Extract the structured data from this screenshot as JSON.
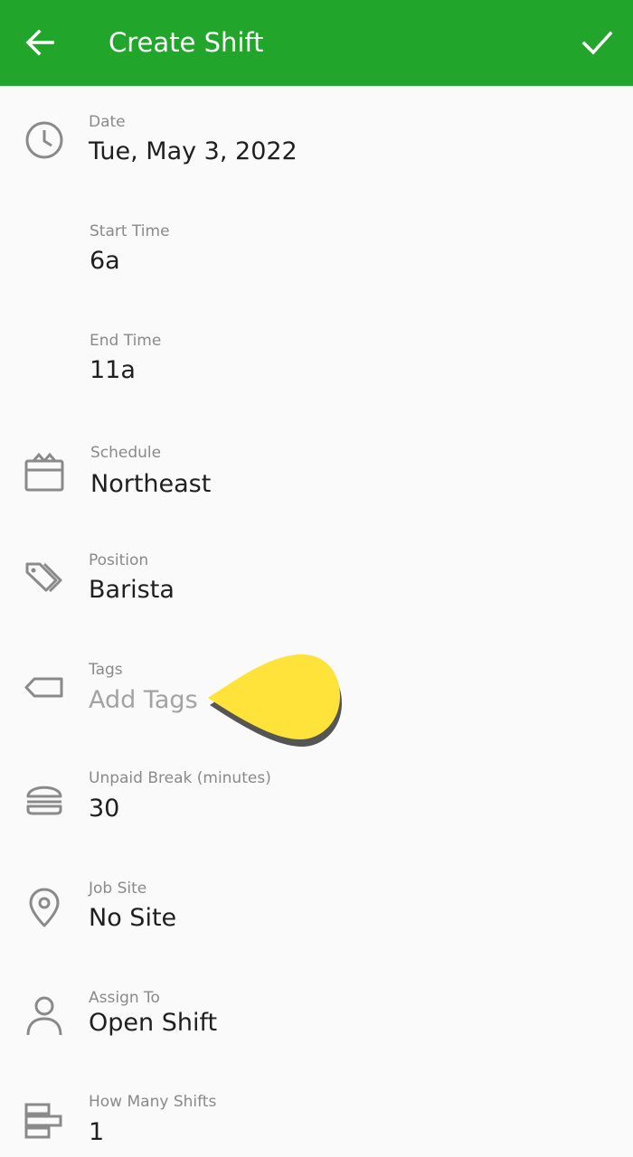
{
  "header": {
    "title": "Create Shift",
    "back_icon": "arrow-back-icon",
    "confirm_icon": "check-icon",
    "background_color": "#22a52b"
  },
  "form": {
    "date": {
      "label": "Date",
      "value": "Tue, May 3, 2022",
      "icon": "clock-icon"
    },
    "start_time": {
      "label": "Start Time",
      "value": "6a"
    },
    "end_time": {
      "label": "End Time",
      "value": "11a"
    },
    "schedule": {
      "label": "Schedule",
      "value": "Northeast",
      "icon": "calendar-icon"
    },
    "position": {
      "label": "Position",
      "value": "Barista",
      "icon": "tags-icon"
    },
    "tags": {
      "label": "Tags",
      "placeholder": "Add Tags",
      "icon": "tag-icon"
    },
    "unpaid_break": {
      "label": "Unpaid Break (minutes)",
      "value": "30",
      "icon": "burger-icon"
    },
    "job_site": {
      "label": "Job Site",
      "value": "No Site",
      "icon": "location-pin-icon"
    },
    "assign_to": {
      "label": "Assign To",
      "value": "Open Shift",
      "icon": "person-icon"
    },
    "how_many_shifts": {
      "label": "How Many Shifts",
      "value": "1",
      "icon": "shifts-stack-icon"
    }
  },
  "tooltip": {
    "color": "#ffe23a"
  }
}
